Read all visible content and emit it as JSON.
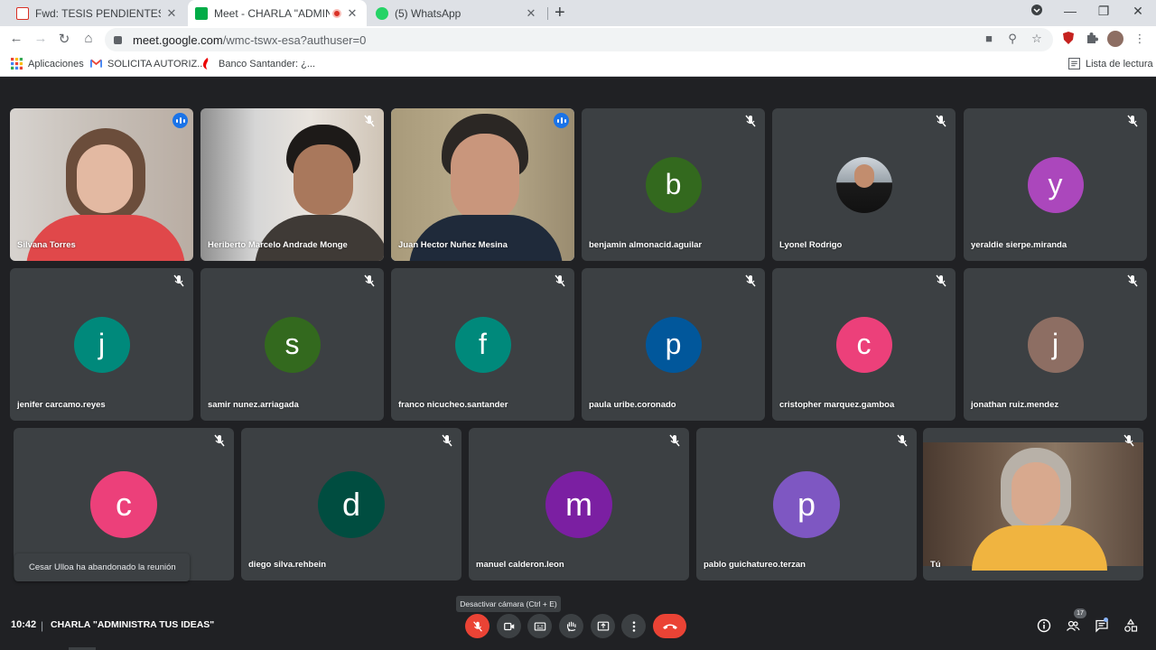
{
  "browser": {
    "tabs": [
      {
        "title": "Fwd: TESIS PENDIENTES - valeria",
        "favicon": "gmail-icon"
      },
      {
        "title": "Meet - CHARLA \"ADMINISTR",
        "favicon": "meet-icon",
        "active": true
      },
      {
        "title": "(5) WhatsApp",
        "favicon": "whatsapp-icon"
      }
    ],
    "url_host": "meet.google.com",
    "url_path": "/wmc-tswx-esa?authuser=0",
    "bookmarks": [
      {
        "label": "Aplicaciones",
        "icon": "apps-grid-icon"
      },
      {
        "label": "SOLICITA AUTORIZ...",
        "icon": "gmail-icon"
      },
      {
        "label": "Banco Santander: ¿...",
        "icon": "santander-icon"
      }
    ],
    "reading_list": "Lista de lectura"
  },
  "meet": {
    "tiles": [
      {
        "name": "Silvana Torres",
        "type": "video",
        "speaking": true
      },
      {
        "name": "Heriberto Marcelo Andrade Monge",
        "type": "video",
        "muted": true
      },
      {
        "name": "Juan Hector Nuñez Mesina",
        "type": "video",
        "speaking": true,
        "highlighted": true
      },
      {
        "name": "benjamin almonacid.aguilar",
        "type": "avatar",
        "initial": "b",
        "color": "#33691e",
        "muted": true
      },
      {
        "name": "Lyonel Rodrigo",
        "type": "photo",
        "muted": true
      },
      {
        "name": "yeraldie sierpe.miranda",
        "type": "avatar",
        "initial": "y",
        "color": "#ab47bc",
        "muted": true
      },
      {
        "name": "jenifer carcamo.reyes",
        "type": "avatar",
        "initial": "j",
        "color": "#00897b",
        "muted": true
      },
      {
        "name": "samir nunez.arriagada",
        "type": "avatar",
        "initial": "s",
        "color": "#33691e",
        "muted": true
      },
      {
        "name": "franco nicucheo.santander",
        "type": "avatar",
        "initial": "f",
        "color": "#00897b",
        "muted": true
      },
      {
        "name": "paula uribe.coronado",
        "type": "avatar",
        "initial": "p",
        "color": "#01579b",
        "muted": true
      },
      {
        "name": "cristopher marquez.gamboa",
        "type": "avatar",
        "initial": "c",
        "color": "#ec407a",
        "muted": true
      },
      {
        "name": "jonathan ruiz.mendez",
        "type": "avatar",
        "initial": "j",
        "color": "#8d6e63",
        "muted": true
      },
      {
        "name": "",
        "type": "avatar",
        "initial": "c",
        "color": "#ec407a",
        "muted": true
      },
      {
        "name": "diego silva.rehbein",
        "type": "avatar",
        "initial": "d",
        "color": "#004d40",
        "muted": true
      },
      {
        "name": "manuel calderon.leon",
        "type": "avatar",
        "initial": "m",
        "color": "#7b1fa2",
        "muted": true
      },
      {
        "name": "pablo guichatureo.terzan",
        "type": "avatar",
        "initial": "p",
        "color": "#7e57c2",
        "muted": true
      },
      {
        "name": "Tú",
        "type": "video-self",
        "muted": true
      }
    ],
    "toast": "Cesar Ulloa ha abandonado la reunión",
    "tooltip": "Desactivar cámara (Ctrl + E)",
    "time": "10:42",
    "separator": "|",
    "meeting_title": "CHARLA \"ADMINISTRA TUS IDEAS\"",
    "participant_count": "17",
    "colors": {
      "accent": "#1a73e8",
      "danger": "#ea4335",
      "tile": "#3c4043",
      "background": "#202124"
    }
  }
}
